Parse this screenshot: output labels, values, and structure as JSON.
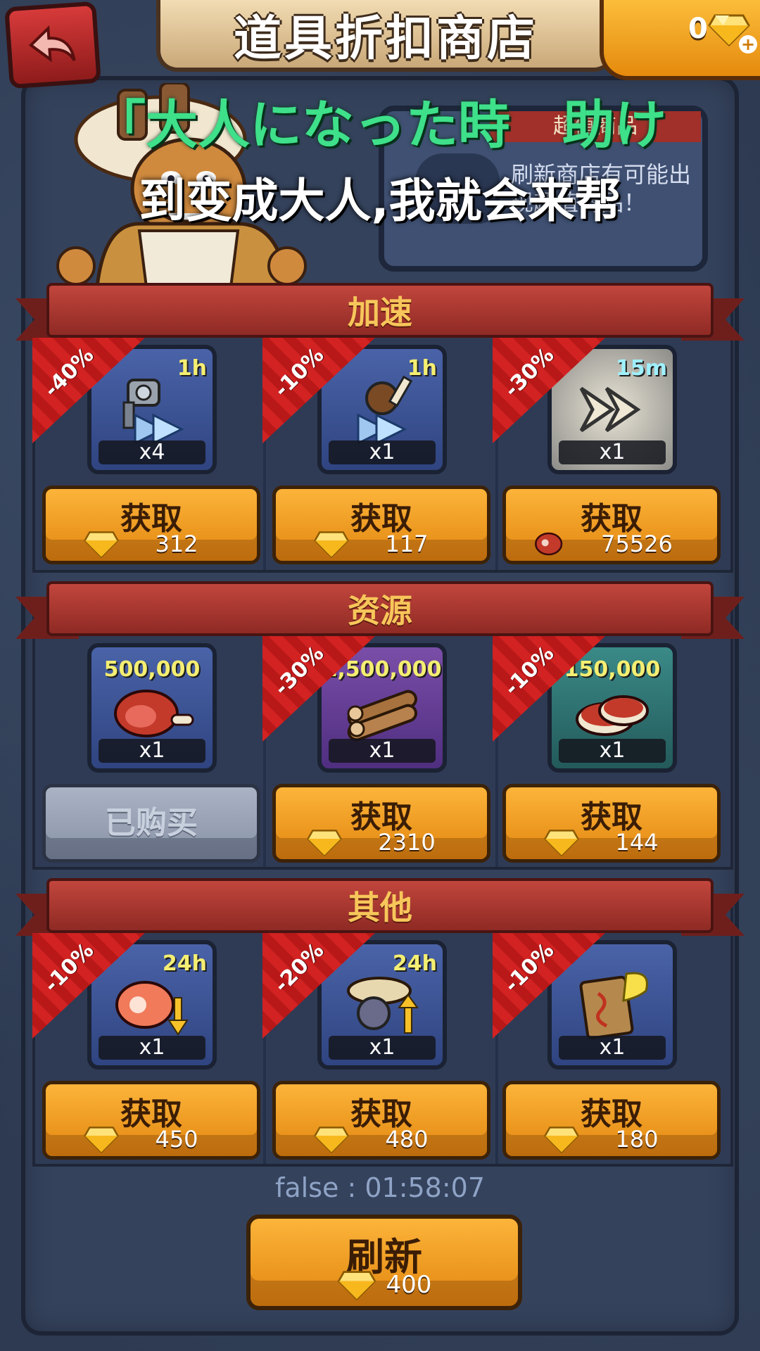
{
  "header": {
    "title": "道具折扣商店",
    "gem_count": "0",
    "back_icon": "back-arrow-icon",
    "gem_icon": "diamond-icon"
  },
  "promo": {
    "ribbon": "超值商品",
    "description": "刷新商店有可能出现超值商品！"
  },
  "subtitles": {
    "japanese": "「大人になった時　助け",
    "chinese": "到变成大人,我就会来帮"
  },
  "sections": [
    {
      "title": "加速",
      "items": [
        {
          "icon": "hammer-speedup-icon",
          "tag": "1h",
          "qty": "x4",
          "discount": "-40%",
          "button": "获取",
          "currency": "diamond",
          "price": "312",
          "disabled": false
        },
        {
          "icon": "caveman-speedup-icon",
          "tag": "1h",
          "qty": "x1",
          "discount": "-10%",
          "button": "获取",
          "currency": "diamond",
          "price": "117",
          "disabled": false
        },
        {
          "icon": "fast-forward-icon",
          "tag": "15m",
          "qty": "x1",
          "discount": "-30%",
          "button": "获取",
          "currency": "meat",
          "price": "75526",
          "disabled": false
        }
      ]
    },
    {
      "title": "资源",
      "items": [
        {
          "icon": "meat-resource-icon",
          "tag": "500,000",
          "qty": "x1",
          "discount": "",
          "button": "已购买",
          "currency": "",
          "price": "",
          "disabled": true
        },
        {
          "icon": "wood-resource-icon",
          "tag": "1,500,000",
          "qty": "x1",
          "discount": "-30%",
          "button": "获取",
          "currency": "diamond",
          "price": "2310",
          "disabled": false
        },
        {
          "icon": "steak-resource-icon",
          "tag": "150,000",
          "qty": "x1",
          "discount": "-10%",
          "button": "获取",
          "currency": "diamond",
          "price": "144",
          "disabled": false
        }
      ]
    },
    {
      "title": "其他",
      "items": [
        {
          "icon": "meat-boost-icon",
          "tag": "24h",
          "qty": "x1",
          "discount": "-10%",
          "button": "获取",
          "currency": "diamond",
          "price": "450",
          "disabled": false
        },
        {
          "icon": "troop-boost-icon",
          "tag": "24h",
          "qty": "x1",
          "discount": "-20%",
          "button": "获取",
          "currency": "diamond",
          "price": "480",
          "disabled": false
        },
        {
          "icon": "rename-scroll-icon",
          "tag": "",
          "qty": "x1",
          "discount": "-10%",
          "button": "获取",
          "currency": "diamond",
          "price": "180",
          "disabled": false
        }
      ]
    }
  ],
  "footer": {
    "timer": "false : 01:58:07",
    "refresh_label": "刷新",
    "refresh_price": "400"
  },
  "colors": {
    "background": "#2d3a52",
    "banner_red": "#a1302a",
    "button_orange": "#f0a020",
    "discount_red": "#d22222",
    "subtitle_green": "#3ee08a"
  }
}
